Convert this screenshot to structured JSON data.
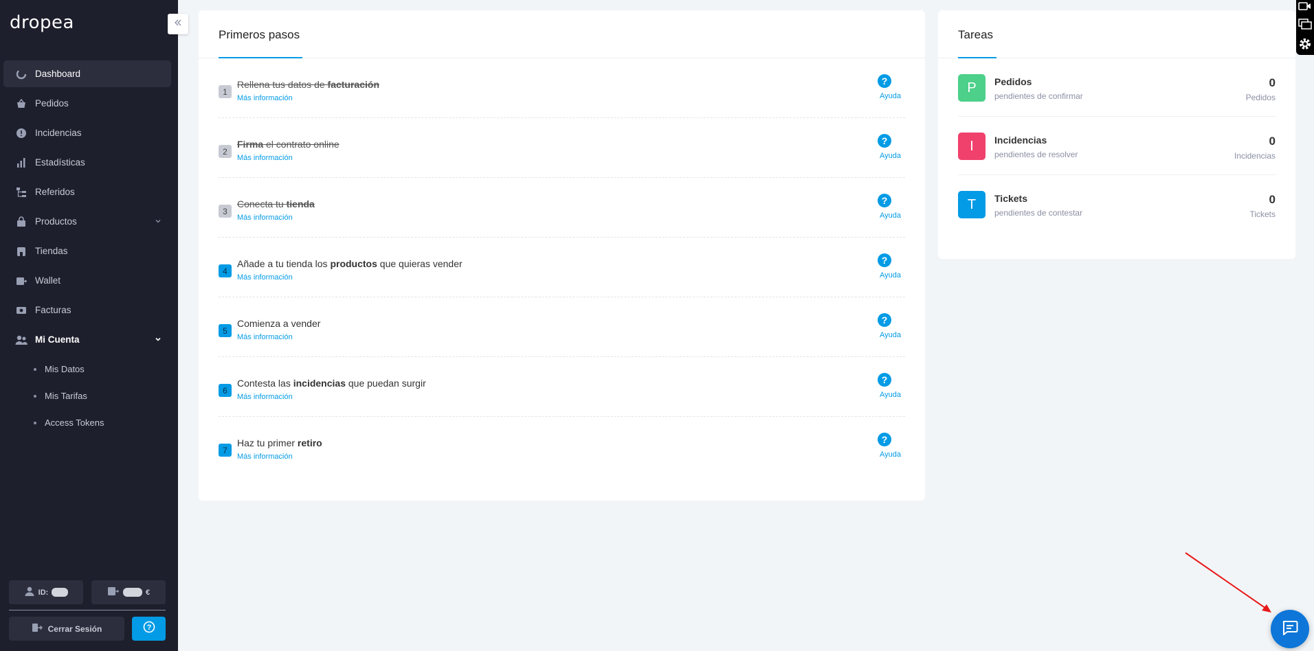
{
  "brand": {
    "logo_text": "dropea"
  },
  "sidebar": {
    "items": [
      {
        "label": "Dashboard",
        "icon": "dashboard-icon"
      },
      {
        "label": "Pedidos",
        "icon": "basket-icon"
      },
      {
        "label": "Incidencias",
        "icon": "alert-icon"
      },
      {
        "label": "Estadísticas",
        "icon": "stats-icon"
      },
      {
        "label": "Referidos",
        "icon": "referral-icon"
      },
      {
        "label": "Productos",
        "icon": "bag-icon"
      },
      {
        "label": "Tiendas",
        "icon": "store-icon"
      },
      {
        "label": "Wallet",
        "icon": "wallet-icon"
      },
      {
        "label": "Facturas",
        "icon": "invoice-icon"
      },
      {
        "label": "Mi Cuenta",
        "icon": "users-icon"
      }
    ],
    "subitems": [
      "Mis Datos",
      "Mis Tarifas",
      "Access Tokens"
    ],
    "id_label": "ID:",
    "currency": "€",
    "logout_label": "Cerrar Sesión"
  },
  "steps_card": {
    "title": "Primeros pasos",
    "more_info": "Más información",
    "help_label": "Ayuda",
    "steps": [
      {
        "num": "1",
        "pre": "Rellena tus datos de ",
        "bold": "facturación",
        "post": ""
      },
      {
        "num": "2",
        "pre": "",
        "bold": "Firma",
        "post": " el contrato online"
      },
      {
        "num": "3",
        "pre": "Conecta tu ",
        "bold": "tienda",
        "post": ""
      },
      {
        "num": "4",
        "pre": "Añade a tu tienda los ",
        "bold": "productos",
        "post": " que quieras vender"
      },
      {
        "num": "5",
        "pre": "Comienza a vender",
        "bold": "",
        "post": ""
      },
      {
        "num": "6",
        "pre": "Contesta las ",
        "bold": "incidencias",
        "post": " que puedan surgir"
      },
      {
        "num": "7",
        "pre": "Haz tu primer ",
        "bold": "retiro",
        "post": ""
      }
    ]
  },
  "tasks_card": {
    "title": "Tareas",
    "tasks": [
      {
        "letter": "P",
        "title": "Pedidos",
        "subtitle": "pendientes de confirmar",
        "count": "0",
        "unit": "Pedidos",
        "color": "#4cd08a"
      },
      {
        "letter": "I",
        "title": "Incidencias",
        "subtitle": "pendientes de resolver",
        "count": "0",
        "unit": "Incidencias",
        "color": "#f0416c"
      },
      {
        "letter": "T",
        "title": "Tickets",
        "subtitle": "pendientes de contestar",
        "count": "0",
        "unit": "Tickets",
        "color": "#039be5"
      }
    ]
  },
  "colors": {
    "accent": "#039be5",
    "sidebar_bg": "#1e1f2c",
    "chat_button": "#0d76d8"
  }
}
